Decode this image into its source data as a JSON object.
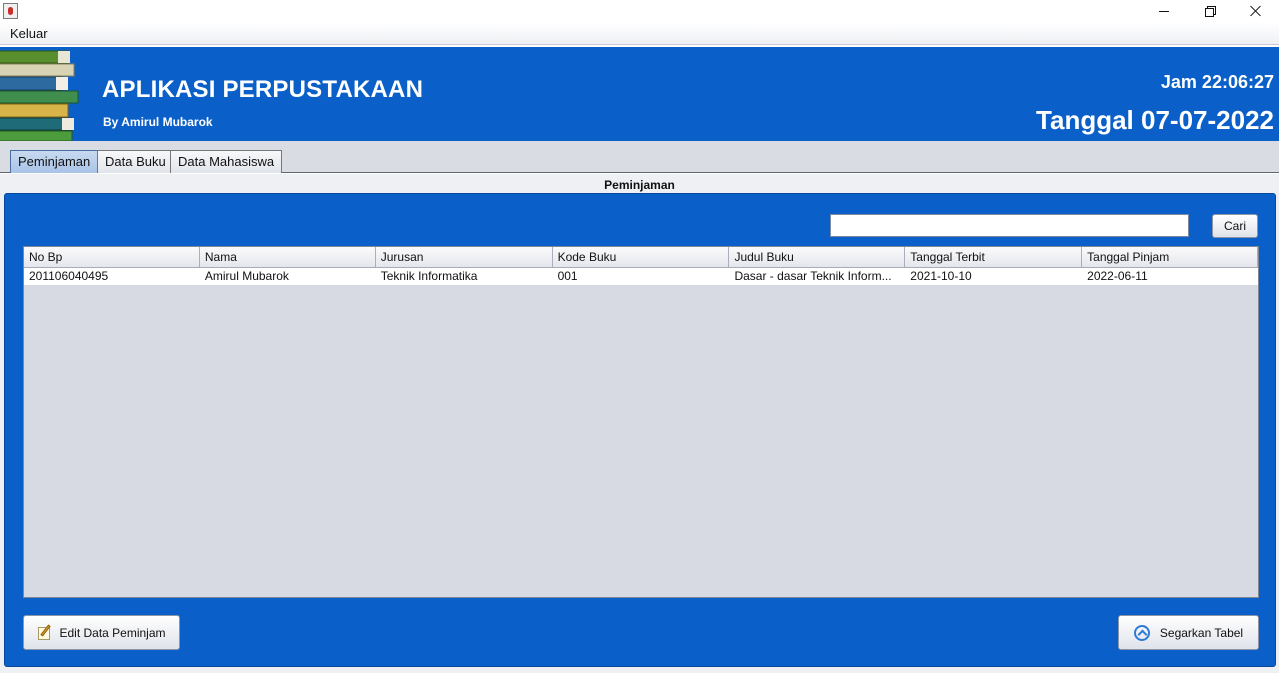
{
  "window": {
    "icon": "java-cup-icon",
    "controls": [
      "minimize-icon",
      "restore-icon",
      "close-icon"
    ]
  },
  "menubar": {
    "items": [
      {
        "label": "Keluar"
      }
    ]
  },
  "header": {
    "title": "APLIKASI PERPUSTAKAAN",
    "author": "By Amirul Mubarok",
    "time_label": "Jam 22:06:27",
    "date_label": "Tanggal 07-07-2022",
    "background_color": "#0a60c8",
    "logo_icon": "books-stack-icon"
  },
  "tabs": [
    {
      "label": "Peminjaman",
      "active": true
    },
    {
      "label": "Data Buku",
      "active": false
    },
    {
      "label": "Data Mahasiswa",
      "active": false
    }
  ],
  "panel": {
    "caption": "Peminjaman",
    "search": {
      "value": "",
      "placeholder": ""
    },
    "search_button": "Cari",
    "table": {
      "columns": [
        "No Bp",
        "Nama",
        "Jurusan",
        "Kode Buku",
        "Judul Buku",
        "Tanggal Terbit",
        "Tanggal Pinjam"
      ],
      "rows": [
        [
          "201106040495",
          "Amirul Mubarok",
          "Teknik Informatika",
          "001",
          "Dasar - dasar Teknik Inform...",
          "2021-10-10",
          "2022-06-11"
        ]
      ]
    },
    "edit_button": {
      "label": "Edit Data Peminjam",
      "icon": "edit-pencil-icon"
    },
    "refresh_button": {
      "label": "Segarkan Tabel",
      "icon": "refresh-icon"
    }
  }
}
